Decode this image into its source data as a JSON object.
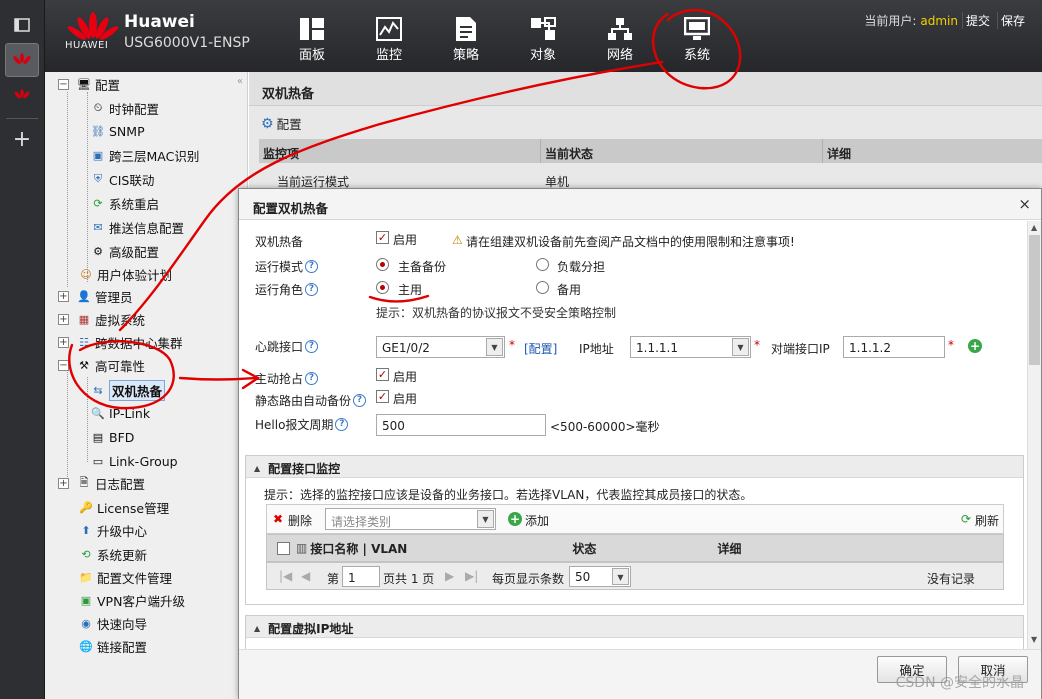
{
  "header": {
    "brand_name": "HUAWEI",
    "product_title": "Huawei",
    "product_model": "USG6000V1-ENSP",
    "nav": [
      {
        "label": "面板",
        "icon": "dashboard-icon"
      },
      {
        "label": "监控",
        "icon": "monitor-chart-icon"
      },
      {
        "label": "策略",
        "icon": "policy-document-icon"
      },
      {
        "label": "对象",
        "icon": "object-icon"
      },
      {
        "label": "网络",
        "icon": "network-topology-icon"
      },
      {
        "label": "系统",
        "icon": "system-monitor-icon",
        "active": true
      }
    ],
    "current_user_label": "当前用户:",
    "current_user": "admin",
    "submit_label": "提交",
    "save_label": "保存"
  },
  "tree": {
    "collapse": "«",
    "items": [
      {
        "label": "配置",
        "expander": "−"
      },
      {
        "label": "时钟配置"
      },
      {
        "label": "SNMP"
      },
      {
        "label": "跨三层MAC识别"
      },
      {
        "label": "CIS联动"
      },
      {
        "label": "系统重启"
      },
      {
        "label": "推送信息配置"
      },
      {
        "label": "高级配置"
      },
      {
        "label": "用户体验计划"
      },
      {
        "label": "管理员",
        "expander": "+"
      },
      {
        "label": "虚拟系统",
        "expander": "+"
      },
      {
        "label": "跨数据中心集群",
        "expander": "+"
      },
      {
        "label": "高可靠性",
        "expander": "−"
      },
      {
        "label": "双机热备",
        "selected": true
      },
      {
        "label": "IP-Link"
      },
      {
        "label": "BFD"
      },
      {
        "label": "Link-Group"
      },
      {
        "label": "日志配置",
        "expander": "+"
      },
      {
        "label": "License管理"
      },
      {
        "label": "升级中心"
      },
      {
        "label": "系统更新"
      },
      {
        "label": "配置文件管理"
      },
      {
        "label": "VPN客户端升级"
      },
      {
        "label": "快速向导"
      },
      {
        "label": "链接配置"
      }
    ]
  },
  "panel": {
    "title": "双机热备",
    "config_label": "配置",
    "columns": [
      "监控项",
      "当前状态",
      "详细"
    ],
    "row": [
      "当前运行模式",
      "单机",
      ""
    ]
  },
  "dialog": {
    "title": "配置双机热备",
    "close": "×",
    "hot_standby_label": "双机热备",
    "enable": "启用",
    "warning": "请在组建双机设备前先查阅产品文档中的使用限制和注意事项!",
    "run_mode_label": "运行模式",
    "mode_active_standby": "主备备份",
    "mode_load_sharing": "负载分担",
    "run_role_label": "运行角色",
    "role_primary": "主用",
    "role_backup": "备用",
    "hint_protocol": "提示：双机热备的协议报文不受安全策略控制",
    "heartbeat_label": "心跳接口",
    "heartbeat_value": "GE1/0/2",
    "configure_link": "[配置]",
    "ip_label": "IP地址",
    "ip_value": "1.1.1.1",
    "peer_ip_label": "对端接口IP",
    "peer_ip_value": "1.1.1.2",
    "preempt_label": "主动抢占",
    "static_route_label": "静态路由自动备份",
    "hello_label": "Hello报文周期",
    "hello_value": "500",
    "hello_range": "<500-60000>毫秒",
    "asterisk": "*",
    "help": "?",
    "monitor_section": {
      "title": "配置接口监控",
      "hint": "提示：选择的监控接口应该是设备的业务接口。若选择VLAN，代表监控其成员接口的状态。",
      "delete": "删除",
      "type_placeholder": "请选择类别",
      "add": "添加",
      "refresh": "刷新",
      "columns": [
        "接口名称 | VLAN",
        "状态",
        "详细"
      ],
      "page_prefix": "第",
      "page_value": "1",
      "page_total": "页共 1 页",
      "per_page_label": "每页显示条数",
      "per_page_value": "50",
      "no_records": "没有记录"
    },
    "vip_section_title": "配置虚拟IP地址",
    "ok": "确定",
    "cancel": "取消"
  },
  "watermark": "CSDN @安全的水晶",
  "annotation_color": "#e00000"
}
